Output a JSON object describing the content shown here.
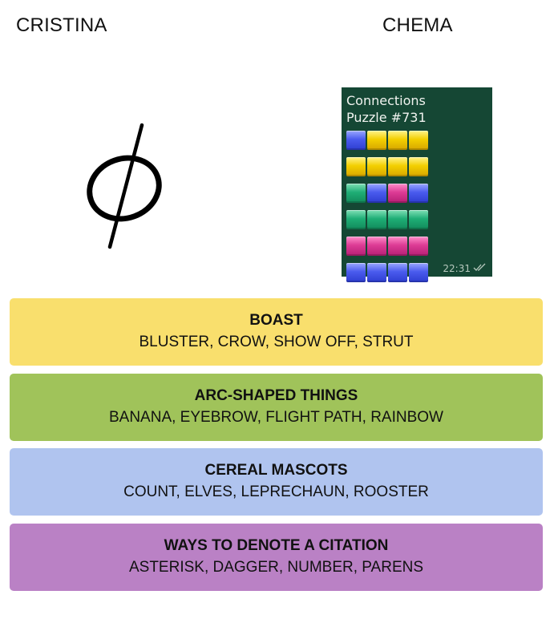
{
  "players": {
    "left": "CRISTINA",
    "right": "CHEMA"
  },
  "left_result_symbol": "ϕ",
  "chat": {
    "line1": "Connections",
    "line2": "Puzzle #731",
    "time": "22:31",
    "grid": [
      [
        "blue",
        "yellow",
        "yellow",
        "yellow"
      ],
      [
        "yellow",
        "yellow",
        "yellow",
        "yellow"
      ],
      [
        "green",
        "blue",
        "purple",
        "blue"
      ],
      [
        "green",
        "green",
        "green",
        "green"
      ],
      [
        "purple",
        "purple",
        "purple",
        "purple"
      ],
      [
        "blue",
        "blue",
        "blue",
        "blue"
      ]
    ]
  },
  "groups": [
    {
      "title": "BOAST",
      "words": "BLUSTER, CROW, SHOW OFF, STRUT",
      "color": "#f9df6d"
    },
    {
      "title": "ARC-SHAPED THINGS",
      "words": "BANANA, EYEBROW, FLIGHT PATH, RAINBOW",
      "color": "#a0c35a"
    },
    {
      "title": "CEREAL MASCOTS",
      "words": "COUNT, ELVES, LEPRECHAUN, ROOSTER",
      "color": "#b0c4ef"
    },
    {
      "title": "WAYS TO DENOTE A CITATION",
      "words": "ASTERISK, DAGGER, NUMBER, PARENS",
      "color": "#ba81c5"
    }
  ]
}
